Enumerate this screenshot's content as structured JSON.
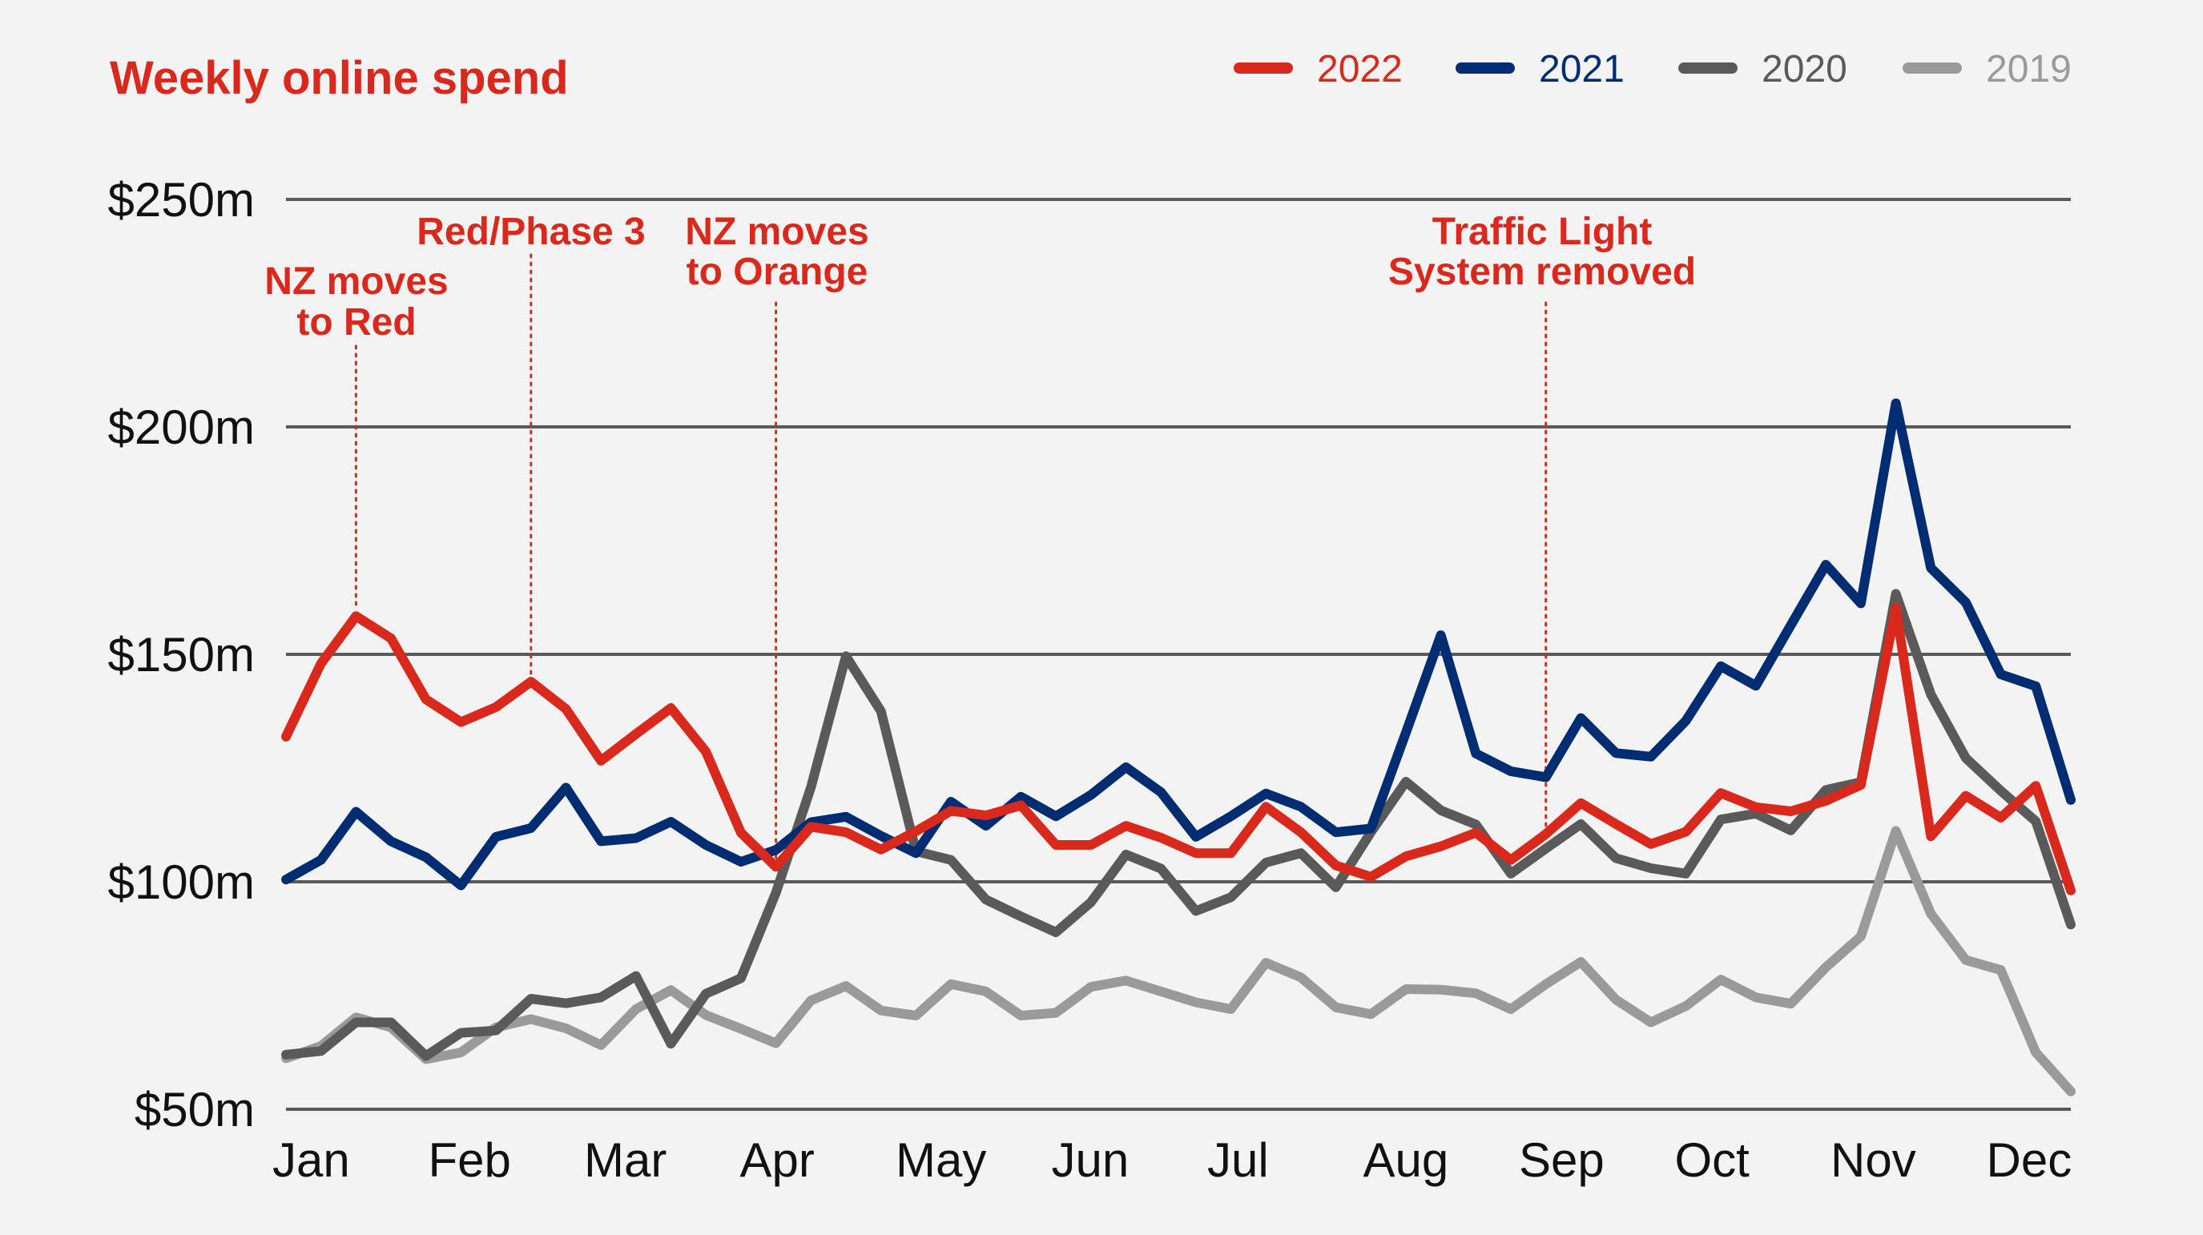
{
  "chart_data": {
    "type": "line",
    "title": "Weekly online spend",
    "xlabel": "",
    "ylabel": "",
    "ylim": [
      50,
      250
    ],
    "yticks": [
      50,
      100,
      150,
      200,
      250
    ],
    "ytick_labels": [
      "$50m",
      "$100m",
      "$150m",
      "$200m",
      "$250m"
    ],
    "grid": true,
    "legend_position": "top-right",
    "x_points": 52,
    "x_unit": "week",
    "month_labels": [
      "Jan",
      "Feb",
      "Mar",
      "Apr",
      "May",
      "Jun",
      "Jul",
      "Aug",
      "Sep",
      "Oct",
      "Nov",
      "Dec"
    ],
    "series": [
      {
        "name": "2019",
        "color": "#9a9a9a",
        "values": [
          61.2,
          63.9,
          70.2,
          68.0,
          61.0,
          62.5,
          68.0,
          69.8,
          67.8,
          64.1,
          72.0,
          76.2,
          70.7,
          67.7,
          64.5,
          73.9,
          77.1,
          71.7,
          70.6,
          77.5,
          75.9,
          70.6,
          71.2,
          76.9,
          78.3,
          75.9,
          73.5,
          72.0,
          82.2,
          79.0,
          72.4,
          70.9,
          76.4,
          76.3,
          75.5,
          72.0,
          77.5,
          82.4,
          74.1,
          69.1,
          72.7,
          78.5,
          74.6,
          73.2,
          81.2,
          88.0,
          111.2,
          93.0,
          82.8,
          80.6,
          62.5,
          53.9
        ]
      },
      {
        "name": "2020",
        "color": "#5a5a5a",
        "values": [
          62.0,
          62.8,
          69.1,
          69.1,
          61.7,
          66.8,
          67.3,
          74.3,
          73.3,
          74.6,
          79.3,
          64.4,
          75.4,
          78.8,
          97.6,
          120.8,
          149.6,
          137.5,
          106.7,
          104.8,
          96.1,
          92.4,
          88.9,
          95.5,
          106.0,
          102.9,
          93.6,
          96.6,
          104.2,
          106.3,
          98.8,
          110.9,
          122.0,
          115.7,
          112.6,
          101.8,
          107.3,
          112.7,
          105.2,
          103.0,
          101.8,
          113.7,
          115.0,
          111.3,
          120.2,
          121.9,
          163.3,
          141.2,
          127.2,
          120.0,
          113.3,
          90.6
        ]
      },
      {
        "name": "2021",
        "color": "#002d72",
        "values": [
          100.5,
          104.8,
          115.4,
          108.9,
          105.4,
          99.2,
          109.9,
          111.8,
          120.7,
          108.9,
          109.6,
          113.2,
          108.1,
          104.4,
          107.0,
          113.1,
          114.3,
          110.1,
          106.3,
          117.6,
          112.3,
          118.7,
          114.4,
          119.1,
          125.2,
          119.7,
          109.9,
          114.4,
          119.4,
          116.5,
          110.9,
          111.7,
          132.8,
          154.2,
          128.2,
          124.3,
          123.0,
          136.0,
          128.3,
          127.5,
          135.4,
          147.4,
          143.1,
          156.4,
          169.7,
          161.2,
          205.2,
          169.0,
          161.4,
          145.6,
          143.0,
          118.0
        ]
      },
      {
        "name": "2022",
        "color": "#d9291c",
        "values": [
          131.9,
          148.0,
          158.4,
          153.5,
          140.1,
          135.1,
          138.4,
          144.0,
          138.0,
          126.6,
          132.5,
          138.2,
          128.6,
          110.8,
          103.3,
          112.1,
          110.9,
          107.1,
          111.1,
          115.6,
          114.6,
          116.8,
          108.1,
          108.1,
          112.3,
          109.7,
          106.3,
          106.3,
          116.5,
          110.9,
          103.6,
          101.1,
          105.6,
          107.8,
          110.8,
          104.8,
          110.5,
          117.3,
          112.7,
          108.3,
          111.0,
          119.5,
          116.4,
          115.5,
          117.8,
          121.3,
          160.2,
          110.0,
          118.9,
          114.1,
          121.1,
          98.1
        ]
      }
    ],
    "legend": [
      {
        "label": "2022",
        "color": "#d9291c"
      },
      {
        "label": "2021",
        "color": "#002d72"
      },
      {
        "label": "2020",
        "color": "#5a5a5a"
      },
      {
        "label": "2019",
        "color": "#9a9a9a"
      }
    ],
    "annotations": [
      {
        "lines": [
          "NZ moves",
          "to Red"
        ],
        "week_index": 2,
        "series": "2022"
      },
      {
        "lines": [
          "Red/Phase 3"
        ],
        "week_index": 7,
        "series": "2022"
      },
      {
        "lines": [
          "NZ moves",
          "to Orange"
        ],
        "week_index": 14,
        "series": "2022"
      },
      {
        "lines": [
          "Traffic Light",
          "System removed"
        ],
        "week_index": 36,
        "series": "2022"
      }
    ],
    "annotation_color": "#d9291c"
  }
}
